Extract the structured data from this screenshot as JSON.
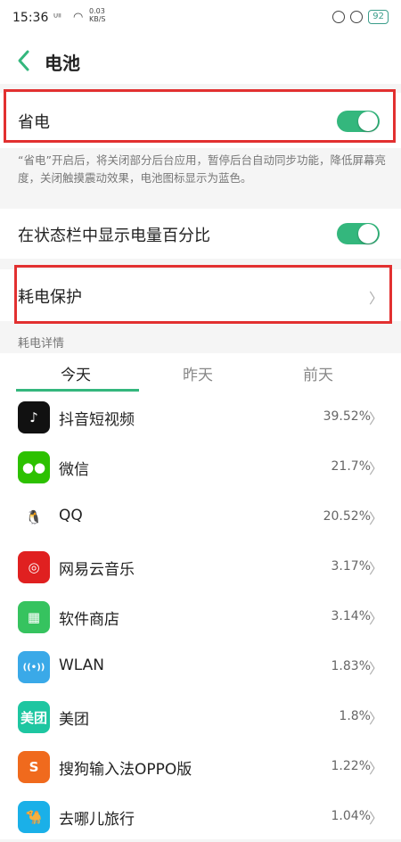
{
  "status_bar": {
    "time": "15:36",
    "signal": "ᵁˡˡ",
    "speed_value": "0.03",
    "speed_unit": "KB/S",
    "battery": "92"
  },
  "header": {
    "title": "电池"
  },
  "power_saving": {
    "label": "省电",
    "enabled": true,
    "description": "“省电”开启后，将关闭部分后台应用，暂停后台自动同步功能，降低屏幕亮度，关闭触摸震动效果，电池图标显示为蓝色。"
  },
  "battery_percent": {
    "label": "在状态栏中显示电量百分比",
    "enabled": true
  },
  "power_protection": {
    "label": "耗电保护",
    "chevron": "〉"
  },
  "details": {
    "section_title": "耗电详情",
    "tabs": [
      "今天",
      "昨天",
      "前天"
    ],
    "active_tab": 0,
    "apps": [
      {
        "name": "抖音短视频",
        "percent": "39.52%",
        "icon": "douyin-icon",
        "color": "#111111",
        "glyph": "♪"
      },
      {
        "name": "微信",
        "percent": "21.7%",
        "icon": "wechat-icon",
        "color": "#2dc100",
        "glyph": "●●"
      },
      {
        "name": "QQ",
        "percent": "20.52%",
        "icon": "qq-penguin-icon",
        "color": "#ffffff",
        "glyph": "🐧"
      },
      {
        "name": "网易云音乐",
        "percent": "3.17%",
        "icon": "netease-music-icon",
        "color": "#e02020",
        "glyph": "◎"
      },
      {
        "name": "软件商店",
        "percent": "3.14%",
        "icon": "app-store-icon",
        "color": "#36c35f",
        "glyph": "▦"
      },
      {
        "name": "WLAN",
        "percent": "1.83%",
        "icon": "wifi-icon",
        "color": "#3aa9e8",
        "glyph": "((•))"
      },
      {
        "name": "美团",
        "percent": "1.8%",
        "icon": "meituan-icon",
        "color": "#1ec6a1",
        "glyph": "美团"
      },
      {
        "name": "搜狗输入法OPPO版",
        "percent": "1.22%",
        "icon": "sogou-icon",
        "color": "#f06a1d",
        "glyph": "S"
      },
      {
        "name": "去哪儿旅行",
        "percent": "1.04%",
        "icon": "qunar-icon",
        "color": "#1ab0e8",
        "glyph": "🐪"
      }
    ]
  },
  "colors": {
    "accent": "#34b77d",
    "highlight": "#e23030"
  }
}
